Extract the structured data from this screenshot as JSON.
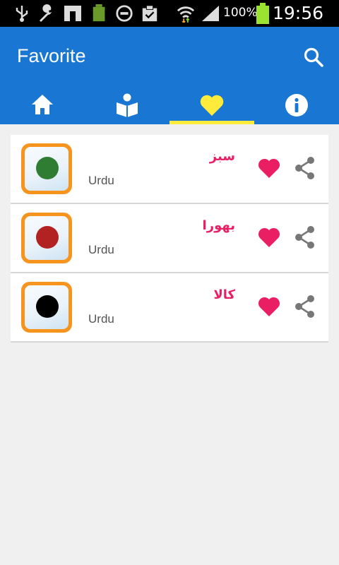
{
  "status_bar": {
    "battery_percent": "100%",
    "clock": "19:56"
  },
  "app_bar": {
    "title": "Favorite",
    "search_icon": "search-icon"
  },
  "tabs": [
    {
      "icon": "home-icon",
      "active": false
    },
    {
      "icon": "reading-icon",
      "active": false
    },
    {
      "icon": "heart-icon",
      "active": true
    },
    {
      "icon": "info-icon",
      "active": false
    }
  ],
  "favorites": [
    {
      "word": "سبز",
      "language": "Urdu",
      "color": "#2e7d32"
    },
    {
      "word": "بھورا",
      "language": "Urdu",
      "color": "#b22222"
    },
    {
      "word": "کالا",
      "language": "Urdu",
      "color": "#000000"
    }
  ],
  "colors": {
    "primary": "#1976d2",
    "tab_indicator": "#ffeb3b",
    "accent": "#e91e63"
  }
}
